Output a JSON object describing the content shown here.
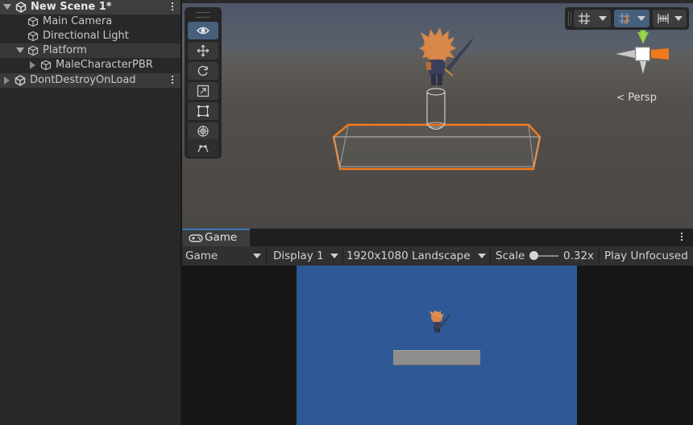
{
  "hierarchy": {
    "scene_name": "New Scene 1*",
    "items": [
      {
        "label": "Main Camera"
      },
      {
        "label": "Directional Light"
      },
      {
        "label": "Platform"
      },
      {
        "label": "MaleCharacterPBR"
      }
    ],
    "dont_destroy": "DontDestroyOnLoad"
  },
  "scene_view": {
    "projection_label": "Persp",
    "tools": [
      "view-tool",
      "move-tool",
      "rotate-tool",
      "scale-tool",
      "rect-tool",
      "transform-tool",
      "custom-tool"
    ],
    "active_tool": "view-tool"
  },
  "game_view": {
    "tab_label": "Game",
    "mode_dropdown": "Game",
    "display_dropdown": "Display 1",
    "resolution_dropdown": "1920x1080 Landscape",
    "scale_label": "Scale",
    "scale_value": "0.32x",
    "scale_slider_fraction": 0.0,
    "play_mode": "Play Unfocused"
  },
  "colors": {
    "selection_outline": "#f07a1c",
    "game_background": "#2f5996",
    "tab_accent": "#3a79bb",
    "active_tool": "#46607c"
  }
}
